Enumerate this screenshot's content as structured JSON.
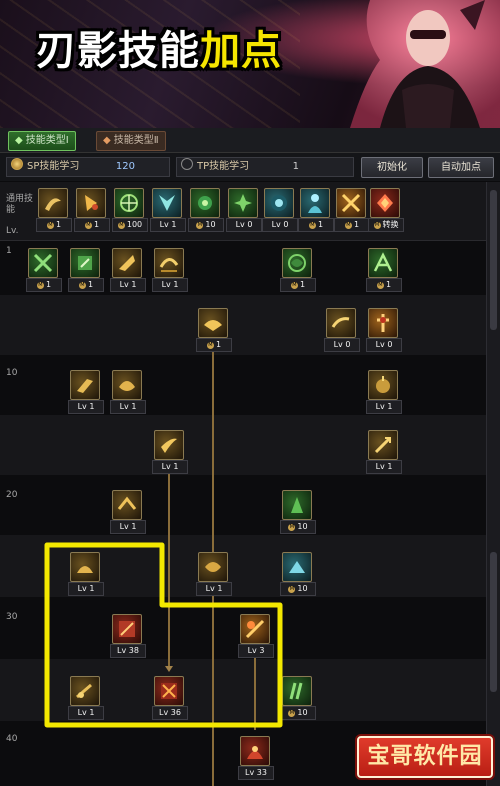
{
  "banner": {
    "title_white": "刃影技能",
    "title_yellow": "加点"
  },
  "tabs": {
    "active": "技能类型Ⅰ",
    "inactive": "技能类型Ⅱ"
  },
  "sp": {
    "label": "SP技能学习",
    "value": "120"
  },
  "tp": {
    "label": "TP技能学习",
    "value": "1"
  },
  "buttons": {
    "reset": "初始化",
    "auto": "自动加点"
  },
  "labels": {
    "common": "通用技能",
    "lv_header": "Lv.",
    "lv1": "1",
    "lv10": "10",
    "lv20": "20",
    "lv30": "30",
    "lv40": "40"
  },
  "common_skills": [
    {
      "cap": "1",
      "tone": "gold",
      "medal": true
    },
    {
      "cap": "1",
      "tone": "gold",
      "medal": true
    },
    {
      "cap": "100",
      "tone": "green",
      "medal": true
    },
    {
      "cap": "Lv 1",
      "tone": "teal",
      "medal": false
    },
    {
      "cap": "10",
      "tone": "green",
      "medal": true
    },
    {
      "cap": "Lv 0",
      "tone": "green",
      "medal": false
    },
    {
      "cap": "Lv 0",
      "tone": "teal",
      "medal": false
    },
    {
      "cap": "1",
      "tone": "teal",
      "medal": true
    },
    {
      "cap": "1",
      "tone": "orange",
      "medal": true
    },
    {
      "cap": "转换",
      "tone": "red",
      "medal": true
    }
  ],
  "tree_skills": [
    {
      "id": "r1a",
      "cap": "1",
      "tone": "green",
      "medal": true
    },
    {
      "id": "r1b",
      "cap": "1",
      "tone": "green",
      "medal": true
    },
    {
      "id": "r1c",
      "cap": "Lv 1",
      "tone": "gold",
      "medal": false
    },
    {
      "id": "r1d",
      "cap": "Lv 1",
      "tone": "gold",
      "medal": false
    },
    {
      "id": "r1e",
      "cap": "1",
      "tone": "green",
      "medal": true
    },
    {
      "id": "r1f",
      "cap": "1",
      "tone": "green",
      "medal": true
    },
    {
      "id": "r5a",
      "cap": "1",
      "tone": "gold",
      "medal": true
    },
    {
      "id": "r5b",
      "cap": "Lv 0",
      "tone": "gold",
      "medal": false
    },
    {
      "id": "r5c",
      "cap": "Lv 0",
      "tone": "orange",
      "medal": false
    },
    {
      "id": "r10a",
      "cap": "Lv 1",
      "tone": "gold",
      "medal": false
    },
    {
      "id": "r10b",
      "cap": "Lv 1",
      "tone": "gold",
      "medal": false
    },
    {
      "id": "r10c",
      "cap": "Lv 1",
      "tone": "gold",
      "medal": false
    },
    {
      "id": "r15a",
      "cap": "Lv 1",
      "tone": "gold",
      "medal": false
    },
    {
      "id": "r15b",
      "cap": "Lv 1",
      "tone": "gold",
      "medal": false
    },
    {
      "id": "r20a",
      "cap": "Lv 1",
      "tone": "gold",
      "medal": false
    },
    {
      "id": "r20b",
      "cap": "10",
      "tone": "green",
      "medal": true
    },
    {
      "id": "r25a",
      "cap": "Lv 1",
      "tone": "gold",
      "medal": false
    },
    {
      "id": "r25b",
      "cap": "Lv 1",
      "tone": "gold",
      "medal": false
    },
    {
      "id": "r25c",
      "cap": "10",
      "tone": "teal",
      "medal": true
    },
    {
      "id": "r30a",
      "cap": "Lv 38",
      "tone": "red",
      "medal": false
    },
    {
      "id": "r30b",
      "cap": "Lv 3",
      "tone": "orange",
      "medal": false
    },
    {
      "id": "r35a",
      "cap": "Lv 1",
      "tone": "gold",
      "medal": false
    },
    {
      "id": "r35b",
      "cap": "Lv 36",
      "tone": "red",
      "medal": false
    },
    {
      "id": "r35c",
      "cap": "10",
      "tone": "green",
      "medal": true
    },
    {
      "id": "r40a",
      "cap": "Lv 33",
      "tone": "red",
      "medal": false
    }
  ],
  "watermark": "宝哥软件园"
}
